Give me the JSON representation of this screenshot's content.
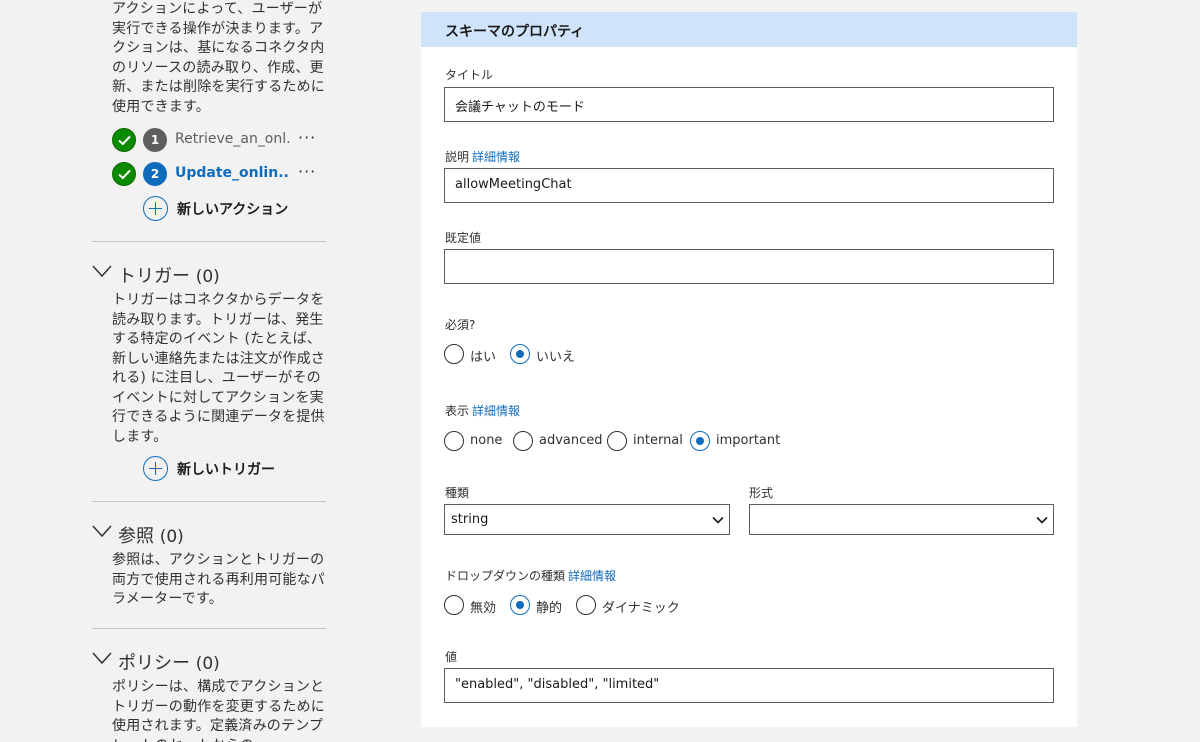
{
  "actions_section": {
    "description": "アクションによって、ユーザーが実行できる操作が決まります。アクションは、基になるコネクタ内のリソースの読み取り、作成、更新、または削除を実行するために使用できます。",
    "items": [
      {
        "number": "1",
        "label": "Retrieve_an_onl...",
        "more": "···"
      },
      {
        "number": "2",
        "label": "Update_onlin...",
        "more": "···"
      }
    ],
    "new_label": "新しいアクション"
  },
  "triggers_section": {
    "title": "トリガー",
    "count": "(0)",
    "description": "トリガーはコネクタからデータを読み取ります。トリガーは、発生する特定のイベント (たとえば、新しい連絡先または注文が作成される) に注目し、ユーザーがそのイベントに対してアクションを実行できるように関連データを提供します。",
    "new_label": "新しいトリガー"
  },
  "references_section": {
    "title": "参照",
    "count": "(0)",
    "description": "参照は、アクションとトリガーの両方で使用される再利用可能なパラメーターです。"
  },
  "policies_section": {
    "title": "ポリシー",
    "count": "(0)",
    "description": "ポリシーは、構成でアクションとトリガーの動作を変更するために使用されます。定義済みのテンプレートのセットからの"
  },
  "panel": {
    "header": "スキーマのプロパティ",
    "title_label": "タイトル",
    "title_value": "会議チャットのモード",
    "description_label": "説明",
    "details_link": "詳細情報",
    "description_value": "allowMeetingChat",
    "default_label": "既定値",
    "default_value": "",
    "required_label": "必須?",
    "required_options": [
      "はい",
      "いいえ"
    ],
    "required_selected": "いいえ",
    "visibility_label": "表示",
    "visibility_options": [
      "none",
      "advanced",
      "internal",
      "important"
    ],
    "visibility_selected": "important",
    "type_label": "種類",
    "type_value": "string",
    "format_label": "形式",
    "format_value": "",
    "dropdown_label": "ドロップダウンの種類",
    "dropdown_options": [
      "無効",
      "静的",
      "ダイナミック"
    ],
    "dropdown_selected": "静的",
    "values_label": "値",
    "values_value": "\"enabled\", \"disabled\", \"limited\""
  },
  "colors": {
    "accent": "#0f6cbd",
    "success": "#0b8a00",
    "header_bg": "#cfe4fa"
  }
}
